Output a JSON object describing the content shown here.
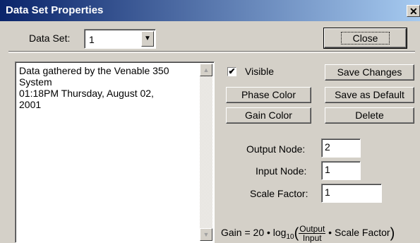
{
  "window": {
    "title": "Data Set Properties",
    "close_glyph": "✕"
  },
  "dataset": {
    "label": "Data Set:",
    "value": "1",
    "arrow": "▼"
  },
  "buttons": {
    "close": "Close",
    "save_changes": "Save Changes",
    "save_default": "Save as Default",
    "phase_color": "Phase Color",
    "gain_color": "Gain Color",
    "delete": "Delete"
  },
  "visible": {
    "label": "Visible",
    "checked": true,
    "check_glyph": "✔"
  },
  "description": {
    "line1": "Data gathered by the Venable 350",
    "line2": "System",
    "line3": "01:18PM Thursday, August 02,",
    "line4": "2001"
  },
  "scroll": {
    "up": "▲",
    "down": "▼"
  },
  "fields": {
    "output_node": {
      "label": "Output Node:",
      "value": "2"
    },
    "input_node": {
      "label": "Input Node:",
      "value": "1"
    },
    "scale_factor": {
      "label": "Scale Factor:",
      "value": "1"
    }
  },
  "formula": {
    "prefix": "Gain = 20 • log",
    "sub": "10",
    "open": "(",
    "numerator": "Output",
    "denominator": "Input",
    "suffix": " • Scale Factor",
    "close": ")"
  }
}
